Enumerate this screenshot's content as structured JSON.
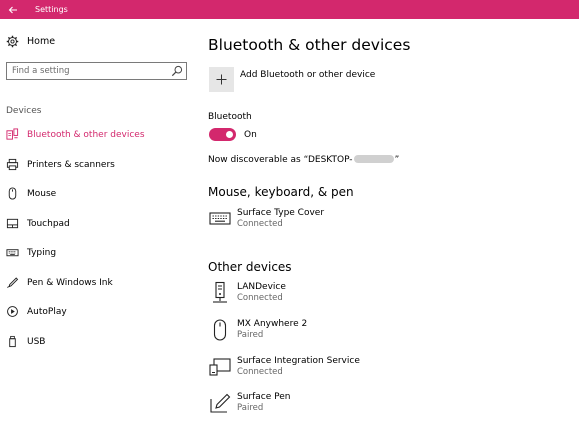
{
  "window": {
    "title": "Settings"
  },
  "sidebar": {
    "home_label": "Home",
    "search": {
      "placeholder": "Find a setting"
    },
    "section_label": "Devices",
    "items": [
      {
        "label": "Bluetooth & other devices",
        "icon": "bluetooth-devices-icon",
        "active": true
      },
      {
        "label": "Printers & scanners",
        "icon": "printer-icon"
      },
      {
        "label": "Mouse",
        "icon": "mouse-icon"
      },
      {
        "label": "Touchpad",
        "icon": "touchpad-icon"
      },
      {
        "label": "Typing",
        "icon": "keyboard-icon"
      },
      {
        "label": "Pen & Windows Ink",
        "icon": "pen-icon"
      },
      {
        "label": "AutoPlay",
        "icon": "autoplay-icon"
      },
      {
        "label": "USB",
        "icon": "usb-icon"
      }
    ]
  },
  "main": {
    "page_title": "Bluetooth & other devices",
    "add_device_label": "Add Bluetooth or other device",
    "bluetooth": {
      "label": "Bluetooth",
      "toggle_state": "On",
      "discoverable_text": "Now discoverable as “DESKTOP-",
      "discoverable_suffix": "”"
    },
    "sections": [
      {
        "heading": "Mouse, keyboard, & pen",
        "devices": [
          {
            "name": "Surface Type Cover",
            "status": "Connected",
            "icon": "keyboard-icon"
          }
        ]
      },
      {
        "heading": "Other devices",
        "devices": [
          {
            "name": "LANDevice",
            "status": "Connected",
            "icon": "network-device-icon"
          },
          {
            "name": "MX Anywhere 2",
            "status": "Paired",
            "icon": "mouse-icon"
          },
          {
            "name": "Surface Integration Service",
            "status": "Connected",
            "icon": "display-device-icon"
          },
          {
            "name": "Surface Pen",
            "status": "Paired",
            "icon": "pen-tablet-icon"
          }
        ]
      }
    ]
  },
  "colors": {
    "accent": "#d3286d",
    "tile": "#e6e6e6",
    "secondary_text": "#666666"
  }
}
